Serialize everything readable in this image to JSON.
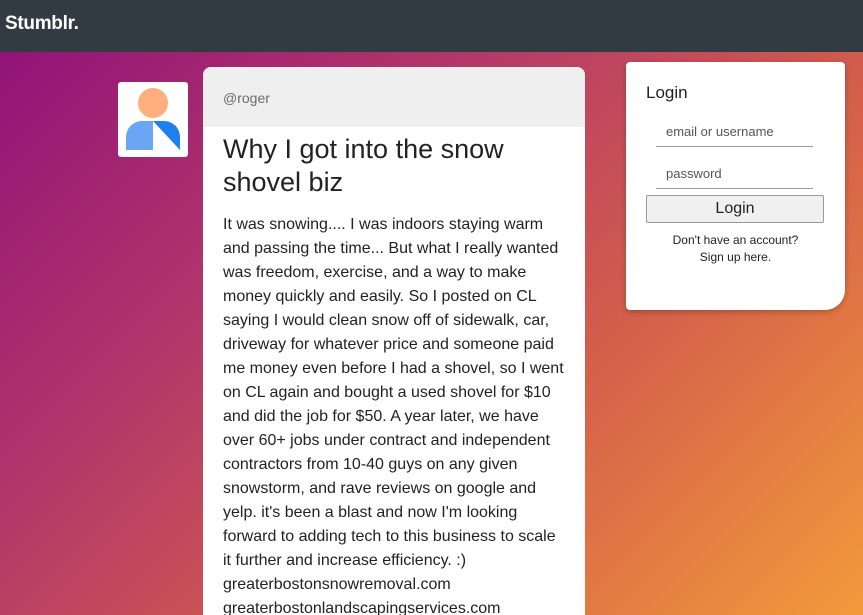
{
  "nav": {
    "brand": "Stumblr."
  },
  "post": {
    "author": "@roger",
    "title": "Why I got into the snow shovel biz",
    "body": "It was snowing.... I was indoors staying warm and passing the time... But what I really wanted was freedom, exercise, and a way to make money quickly and easily. So I posted on CL saying I would clean snow off of sidewalk, car, driveway for whatever price and someone paid me money even before I had a shovel, so I went on CL again and bought a used shovel for $10 and did the job for $50. A year later, we have over 60+ jobs under contract and independent contractors from 10-40 guys on any given snowstorm, and rave reviews on google and yelp. it's been a blast and now I'm looking forward to adding tech to this business to scale it further and increase efficiency. :)",
    "link1": "greaterbostonsnowremoval.com",
    "link2": "greaterbostonlandscapingservices.com"
  },
  "avatar": {
    "icon": "user-avatar-icon",
    "colors": {
      "head": "#fdb07e",
      "body": "#3a8ff0"
    }
  },
  "login": {
    "title": "Login",
    "username_placeholder": "email or username",
    "password_placeholder": "password",
    "button_label": "Login",
    "signup_line1": "Don't have an account?",
    "signup_line2": "Sign up here."
  },
  "colors": {
    "topbar": "#323a42",
    "gradient_start": "#8e0f7a",
    "gradient_end": "#f39a3b"
  }
}
